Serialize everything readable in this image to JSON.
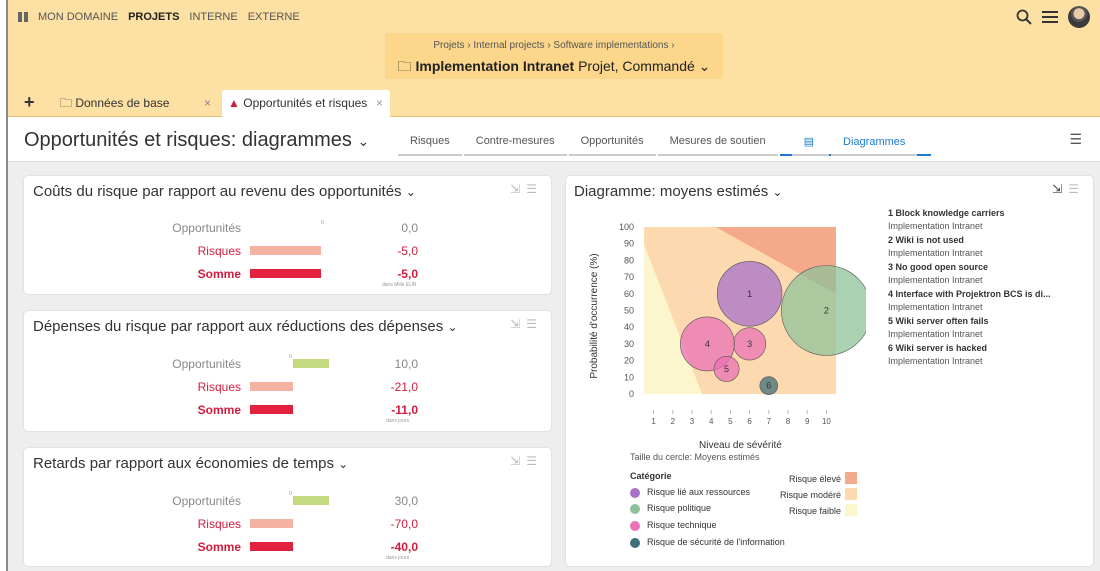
{
  "nav": {
    "items": [
      "MON DOMAINE",
      "PROJETS",
      "INTERNE",
      "EXTERNE"
    ],
    "active": "PROJETS"
  },
  "icons": {
    "search": "search-icon",
    "menu": "hamburger-icon",
    "avatar": "user-avatar"
  },
  "breadcrumb": {
    "path": "Projets  ›  Internal projects  ›  Software implementations  ›",
    "project_name": "Implementation Intranet",
    "project_status": "Projet, Commandé"
  },
  "tabs": [
    {
      "label": "Données de base",
      "icon": "folder-icon",
      "active": false
    },
    {
      "label": "Opportunités et risques",
      "icon": "warning-icon",
      "active": true
    }
  ],
  "page": {
    "title": "Opportunités et risques: diagrammes"
  },
  "subtabs": [
    "Risques",
    "Contre-mesures",
    "Opportunités",
    "Mesures de soutien",
    "Diagrammes"
  ],
  "subtab_active": "Diagrammes",
  "cards": [
    {
      "title": "Coûts du risque par rapport au revenu des opportunités",
      "labels": [
        "Opportunités",
        "Risques",
        "Somme"
      ],
      "values": [
        "0,0",
        "-5,0",
        "-5,0"
      ],
      "unit": "dans Mille EUR",
      "zero_label": "0",
      "bars": [
        0,
        -5,
        -5
      ]
    },
    {
      "title": "Dépenses du risque par rapport aux réductions des dépenses",
      "labels": [
        "Opportunités",
        "Risques",
        "Somme"
      ],
      "values": [
        "10,0",
        "-21,0",
        "-11,0"
      ],
      "unit": "dans jours",
      "zero_label": "0",
      "bars": [
        10,
        -21,
        -11
      ]
    },
    {
      "title": "Retards par rapport aux économies de temps",
      "labels": [
        "Opportunités",
        "Risques",
        "Somme"
      ],
      "values": [
        "30,0",
        "-70,0",
        "-40,0"
      ],
      "unit": "dans jours",
      "zero_label": "0",
      "bars": [
        30,
        -70,
        -40
      ]
    }
  ],
  "diagram": {
    "title": "Diagramme: moyens estimés",
    "ylabel": "Probabilité d'occurrence (%)",
    "xlabel": "Niveau de sévérité",
    "circle_note": "Taille du cercle: Moyens estimés",
    "legend_title": "Catégorie",
    "categories": [
      {
        "label": "Risque lié aux ressources",
        "color": "#a772c8"
      },
      {
        "label": "Risque politique",
        "color": "#8fc29a"
      },
      {
        "label": "Risque technique",
        "color": "#ea72b6"
      },
      {
        "label": "Risque de sécurité de l'information",
        "color": "#3f6f78"
      }
    ],
    "severity": [
      {
        "label": "Risque élevé",
        "color": "#f3a98a"
      },
      {
        "label": "Risque modéré",
        "color": "#fdd9b0"
      },
      {
        "label": "Risque faible",
        "color": "#fcf6cf"
      }
    ],
    "risks": [
      {
        "num": "1 Block knowledge carriers",
        "project": "Implementation Intranet"
      },
      {
        "num": "2 Wiki is not used",
        "project": "Implementation Intranet"
      },
      {
        "num": "3 No good open source",
        "project": "Implementation Intranet"
      },
      {
        "num": "4 Interface with Projektron BCS is di...",
        "project": "Implementation Intranet"
      },
      {
        "num": "5 Wiki server often fails",
        "project": "Implementation Intranet"
      },
      {
        "num": "6 Wiki server is hacked",
        "project": "Implementation Intranet"
      }
    ]
  },
  "chart_data": {
    "type": "scatter",
    "title": "Diagramme: moyens estimés",
    "xlabel": "Niveau de sévérité",
    "ylabel": "Probabilité d'occurrence (%)",
    "xlim": [
      0.5,
      10.5
    ],
    "ylim": [
      0,
      100
    ],
    "xticks": [
      1,
      2,
      3,
      4,
      5,
      6,
      7,
      8,
      9,
      10
    ],
    "yticks": [
      0,
      10,
      20,
      30,
      40,
      50,
      60,
      70,
      80,
      90,
      100
    ],
    "points": [
      {
        "label": "1",
        "x": 6,
        "y": 60,
        "size": 36,
        "category": "Risque lié aux ressources"
      },
      {
        "label": "2",
        "x": 10,
        "y": 50,
        "size": 50,
        "category": "Risque politique"
      },
      {
        "label": "3",
        "x": 6,
        "y": 30,
        "size": 18,
        "category": "Risque technique"
      },
      {
        "label": "4",
        "x": 3.8,
        "y": 30,
        "size": 30,
        "category": "Risque technique"
      },
      {
        "label": "5",
        "x": 4.8,
        "y": 15,
        "size": 14,
        "category": "Risque technique"
      },
      {
        "label": "6",
        "x": 7,
        "y": 5,
        "size": 10,
        "category": "Risque de sécurité de l'information"
      }
    ]
  }
}
